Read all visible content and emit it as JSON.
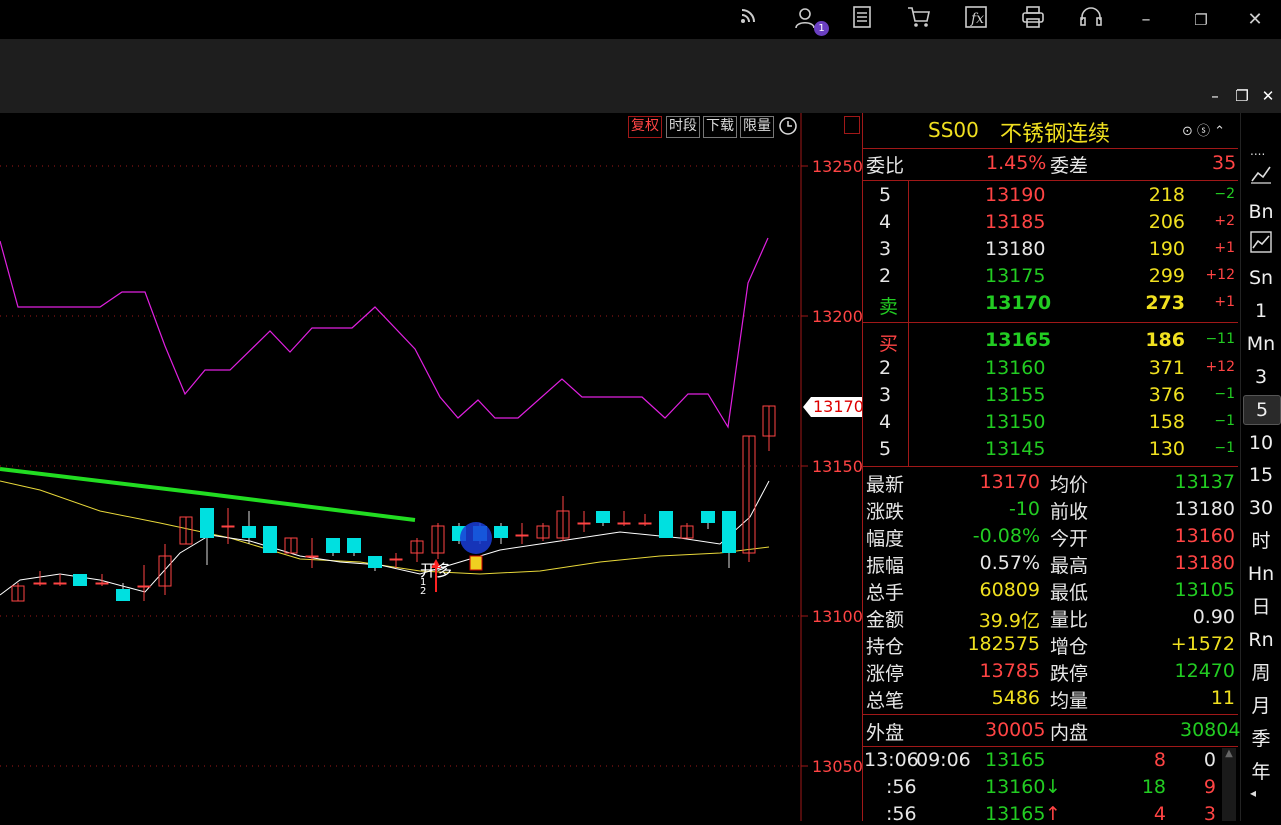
{
  "titlebar": {
    "user_badge": "1"
  },
  "chart": {
    "tools": [
      "复权",
      "时段",
      "下载",
      "限量"
    ],
    "price_ticks": [
      "13250",
      "13200",
      "13150",
      "13100",
      "13050"
    ],
    "current_price_tag": "13170",
    "annotation": "开多",
    "annotation_sub": "1 2"
  },
  "quote": {
    "code": "SS00",
    "name": "不锈钢连续",
    "weibi_label": "委比",
    "weibi": "1.45%",
    "weicha_label": "委差",
    "weicha": "35",
    "asks": [
      {
        "level": "5",
        "price": "13190",
        "vol": "218",
        "chg": "−2"
      },
      {
        "level": "4",
        "price": "13185",
        "vol": "206",
        "chg": "+2"
      },
      {
        "level": "3",
        "price": "13180",
        "vol": "190",
        "chg": "+1"
      },
      {
        "level": "2",
        "price": "13175",
        "vol": "299",
        "chg": "+12"
      },
      {
        "level": "卖",
        "price": "13170",
        "vol": "273",
        "chg": "+1"
      }
    ],
    "bids": [
      {
        "level": "买",
        "price": "13165",
        "vol": "186",
        "chg": "−11"
      },
      {
        "level": "2",
        "price": "13160",
        "vol": "371",
        "chg": "+12"
      },
      {
        "level": "3",
        "price": "13155",
        "vol": "376",
        "chg": "−1"
      },
      {
        "level": "4",
        "price": "13150",
        "vol": "158",
        "chg": "−1"
      },
      {
        "level": "5",
        "price": "13145",
        "vol": "130",
        "chg": "−1"
      }
    ],
    "stats": [
      {
        "l1": "最新",
        "v1": "13170",
        "l2": "均价",
        "v2": "13137"
      },
      {
        "l1": "涨跌",
        "v1": "-10",
        "l2": "前收",
        "v2": "13180"
      },
      {
        "l1": "幅度",
        "v1": "-0.08%",
        "l2": "今开",
        "v2": "13160"
      },
      {
        "l1": "振幅",
        "v1": "0.57%",
        "l2": "最高",
        "v2": "13180"
      },
      {
        "l1": "总手",
        "v1": "60809",
        "l2": "最低",
        "v2": "13105"
      },
      {
        "l1": "金额",
        "v1": "39.9亿",
        "l2": "量比",
        "v2": "0.90"
      },
      {
        "l1": "持仓",
        "v1": "182575",
        "l2": "增仓",
        "v2": "+1572"
      },
      {
        "l1": "涨停",
        "v1": "13785",
        "l2": "跌停",
        "v2": "12470"
      },
      {
        "l1": "总笔",
        "v1": "5486",
        "l2": "均量",
        "v2": "11"
      }
    ],
    "waipan_label": "外盘",
    "waipan": "30005",
    "neipan_label": "内盘",
    "neipan": "30804",
    "ticks": [
      {
        "time": "13:06",
        "time2": "09:06",
        "price": "13165",
        "arrow": "",
        "vol": "8",
        "oi": "0"
      },
      {
        "time": ":56",
        "time2": "",
        "price": "13160",
        "arrow": "↓",
        "vol": "18",
        "oi": "9"
      },
      {
        "time": ":56",
        "time2": "",
        "price": "13165",
        "arrow": "↑",
        "vol": "4",
        "oi": "3"
      }
    ]
  },
  "periods": [
    "Bn",
    "Sn",
    "1",
    "Mn",
    "3",
    "5",
    "10",
    "15",
    "30",
    "时",
    "Hn",
    "日",
    "Rn",
    "周",
    "月",
    "季",
    "年"
  ],
  "colors": {
    "up": "#ff4444",
    "down": "#00e0e0",
    "ma_long": "#22dd22",
    "ma_ref": "#e020e0",
    "panel_line": "#a01818"
  }
}
